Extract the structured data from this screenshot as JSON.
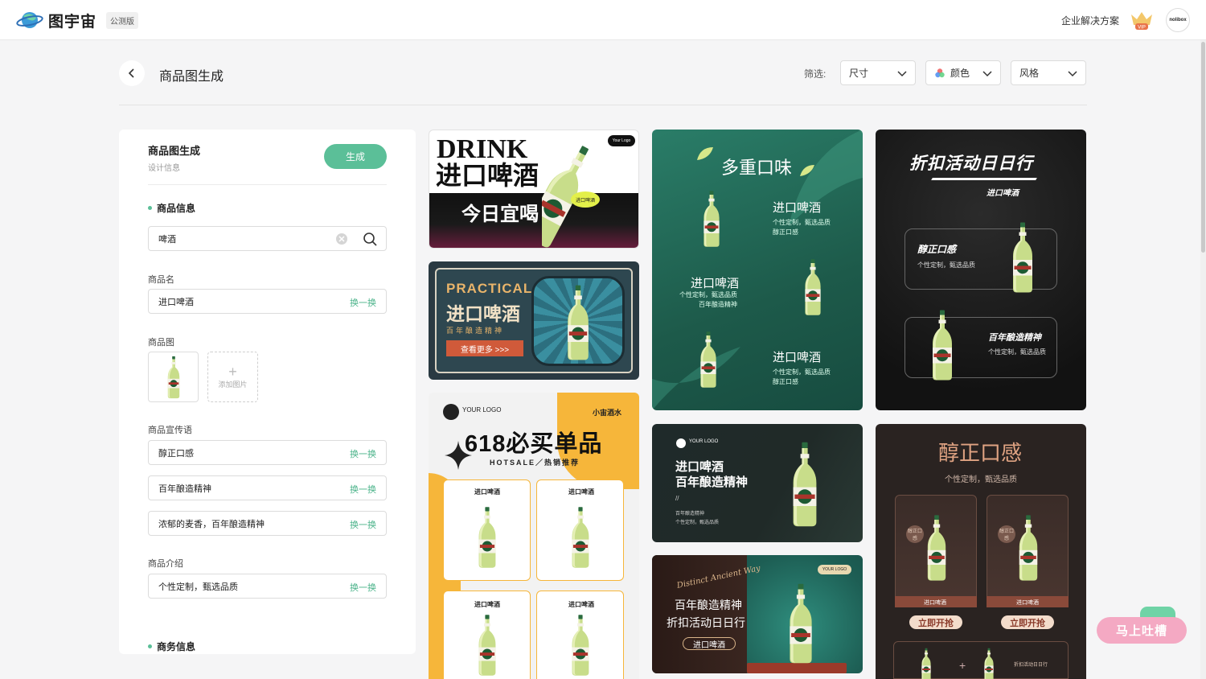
{
  "header": {
    "brand_name": "图宇宙",
    "beta_badge": "公测版",
    "enterprise_link": "企业解决方案",
    "vip_label": "VIP",
    "avatar_text": "nolibox"
  },
  "page": {
    "title": "商品图生成",
    "filter_label": "筛选:",
    "filters": [
      {
        "label": "尺寸"
      },
      {
        "label": "颜色"
      },
      {
        "label": "风格"
      }
    ]
  },
  "panel": {
    "title": "商品图生成",
    "subtitle": "设计信息",
    "generate_label": "生成",
    "product_section": "商品信息",
    "search_value": "啤酒",
    "name_label": "商品名",
    "name_value": "进口啤酒",
    "swap_label": "换一换",
    "image_label": "商品图",
    "add_image_label": "添加图片",
    "slogan_label": "商品宣传语",
    "slogans": [
      "醇正口感",
      "百年酿造精神",
      "浓郁的麦香，百年酿造精神"
    ],
    "intro_label": "商品介绍",
    "intro_value": "个性定制，甄选品质",
    "business_section": "商务信息"
  },
  "cards": {
    "c1": {
      "line1": "DRINK",
      "line2": "进口啤酒",
      "line3": "今日宜喝",
      "logo": "Your Logo",
      "badge": "进口啤酒"
    },
    "c2": {
      "line1": "PRACTICAL",
      "line2": "进口啤酒",
      "line3": "百年酿造精神",
      "button": "查看更多  >>>"
    },
    "c3": {
      "logo": "YOUR LOGO",
      "shop": "小宙酒水",
      "title": "618必买单品",
      "sub": "HOTSALE／热销推荐",
      "item": "进口啤酒"
    },
    "c4": {
      "title": "多重口味",
      "item1": "进口啤酒",
      "desc": "个性定制，甄选品质",
      "desc2": "醇正口感",
      "desc3": "百年酿造精神"
    },
    "c5": {
      "title": "折扣活动日日行",
      "sub": "进口啤酒",
      "b1": "醇正口感",
      "b1d": "个性定制，甄选品质",
      "b2": "百年酿造精神",
      "b2d": "个性定制，甄选品质"
    },
    "c6": {
      "logo": "YOUR LOGO",
      "line1": "进口啤酒",
      "line2": "百年酿造精神",
      "slash": "//",
      "d1": "百年酿造精神",
      "d2": "个性定制，甄选品质"
    },
    "c7": {
      "title": "醇正口感",
      "sub": "个性定制，甄选品质",
      "item": "进口啤酒",
      "tag": "醇正口感",
      "button": "立即开抢",
      "promo": "折扣活动日日行"
    },
    "c8": {
      "script": "Distinct Ancient Way",
      "line1": "百年酿造精神",
      "line2": "折扣活动日日行",
      "button": "进口啤酒",
      "logo": "YOUR LOGO"
    }
  },
  "feedback_button": "马上吐槽",
  "colors": {
    "accent": "#5bbf98",
    "swap": "#4bb38a"
  }
}
